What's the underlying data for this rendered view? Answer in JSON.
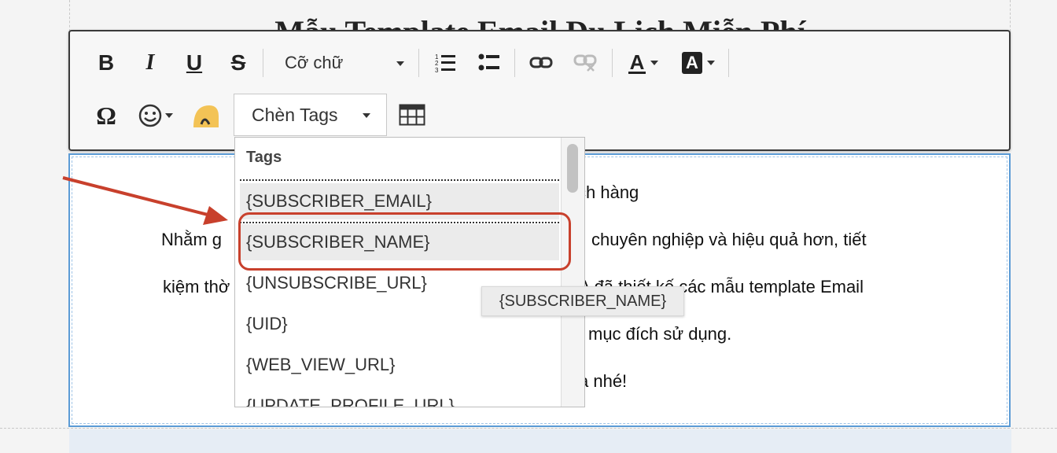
{
  "page": {
    "title": "Mẫu Template Email Du Lịch Miễn Phí"
  },
  "toolbar": {
    "bold_label": "B",
    "italic_label": "I",
    "underline_label": "U",
    "strike_label": "S",
    "font_size_label": "Cỡ chữ",
    "text_color_label": "A",
    "bg_color_label": "A",
    "special_char_label": "Ω",
    "insert_tags_label": "Chèn Tags"
  },
  "editor": {
    "lines": [
      "ch hàng",
      "Nhằm g",
      "chuyên nghiệp và hiệu quả hơn, tiết",
      "kiệm thờ",
      "A đã thiết kế các mẫu template Email",
      "mục đích sử dụng.",
      "a nhé!"
    ]
  },
  "tags_dropdown": {
    "header": "Tags",
    "items": [
      "{SUBSCRIBER_EMAIL}",
      "{SUBSCRIBER_NAME}",
      "{UNSUBSCRIBE_URL}",
      "{UID}",
      "{WEB_VIEW_URL}",
      "{UPDATE_PROFILE_URL}"
    ]
  },
  "tooltip": {
    "text": "{SUBSCRIBER_NAME}"
  },
  "colors": {
    "highlight": "#c8402c",
    "editor_border": "#5b9bd5"
  }
}
